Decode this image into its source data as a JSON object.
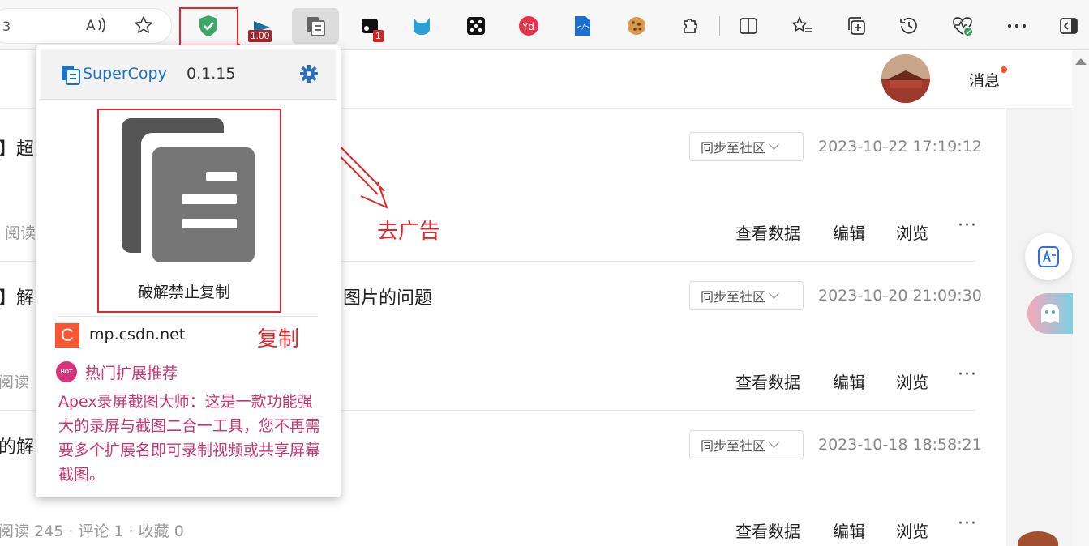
{
  "browser": {
    "address_fragment": "3",
    "extension_badges": {
      "zoom": "1.00",
      "count": "1"
    }
  },
  "header": {
    "messages_label": "消息"
  },
  "articles": [
    {
      "title_fragment": "】超",
      "sync_label": "同步至社区",
      "date": "2023-10-22 17:19:12",
      "meta_fragment": "阅读",
      "actions": [
        "查看数据",
        "编辑",
        "浏览"
      ]
    },
    {
      "title_fragment": "】解",
      "title_tail": "图片的问题",
      "sync_label": "同步至社区",
      "date": "2023-10-20 21:09:30",
      "meta_fragment": "阅读",
      "actions": [
        "查看数据",
        "编辑",
        "浏览"
      ]
    },
    {
      "title_fragment": "的解",
      "sync_label": "同步至社区",
      "date": "2023-10-18 18:58:21",
      "meta_fragment": "阅读 245 · 评论 1 · 收藏 0",
      "actions": [
        "查看数据",
        "编辑",
        "浏览"
      ]
    }
  ],
  "annotations": {
    "remove_ads": "去广告",
    "copy": "复制"
  },
  "popup": {
    "brand": "SuperCopy",
    "version": "0.1.15",
    "copy_action_label": "破解禁止复制",
    "site": "mp.csdn.net",
    "site_icon_letter": "C",
    "hot_title": "热门扩展推荐",
    "hot_badge": "HOT",
    "hot_description": "Apex录屏截图大师：这是一款功能强大的录屏与截图二合一工具，您不再需要多个扩展名即可录制视频或共享屏幕截图。"
  },
  "colors": {
    "annotation_red": "#e3262b",
    "brand_blue": "#1a72c9",
    "promo_pink": "#c73775"
  }
}
